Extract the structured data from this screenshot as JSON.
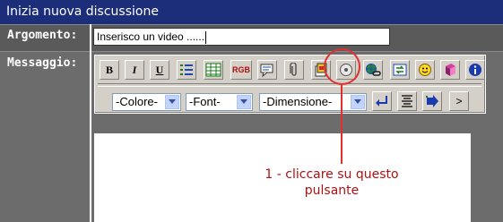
{
  "title": "Inizia nuova discussione",
  "form": {
    "argomento_label": "Argomento:",
    "argomento_value": "Inserisco un video ......",
    "messaggio_label": "Messaggio:"
  },
  "toolbar": {
    "bold_label": "B",
    "italic_label": "I",
    "underline_label": "U",
    "rgb_label": "RGB",
    "colore_select": "-Colore-",
    "font_select": "-Font-",
    "dimensione_select": "-Dimensione-",
    "close_tag_label": ">"
  },
  "annotation": {
    "text": "1 - cliccare su questo pulsante",
    "color": "#e03030"
  }
}
